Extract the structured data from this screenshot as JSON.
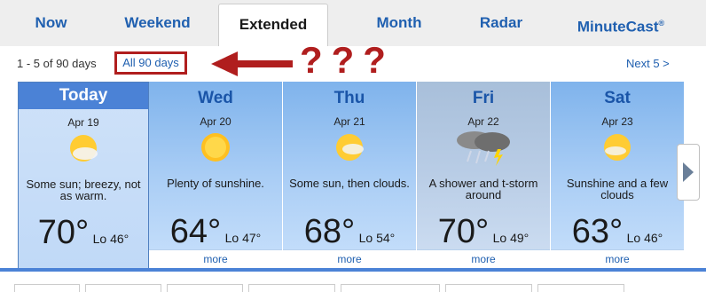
{
  "tabs": [
    {
      "label": "Now"
    },
    {
      "label": "Weekend"
    },
    {
      "label": "Extended"
    },
    {
      "label": "Month"
    },
    {
      "label": "Radar"
    },
    {
      "label": "MinuteCast",
      "sup": "®"
    }
  ],
  "nav": {
    "range": "1 - 5 of 90 days",
    "all_days": "All 90 days",
    "annotation": "???",
    "next": "Next 5 >"
  },
  "days": [
    {
      "name": "Today",
      "date": "Apr 19",
      "icon": "sun-cloud-icon",
      "desc": "Some sun; breezy, not as warm.",
      "hi": "70°",
      "lo": "Lo 46°"
    },
    {
      "name": "Wed",
      "date": "Apr 20",
      "icon": "sun-icon",
      "desc": "Plenty of sunshine.",
      "hi": "64°",
      "lo": "Lo 47°",
      "more": "more"
    },
    {
      "name": "Thu",
      "date": "Apr 21",
      "icon": "sun-cloud-icon",
      "desc": "Some sun, then clouds.",
      "hi": "68°",
      "lo": "Lo 54°",
      "more": "more"
    },
    {
      "name": "Fri",
      "date": "Apr 22",
      "icon": "thunderstorm-icon",
      "desc": "A shower and t-storm around",
      "hi": "70°",
      "lo": "Lo 49°",
      "more": "more"
    },
    {
      "name": "Sat",
      "date": "Apr 23",
      "icon": "sun-cloud-icon",
      "desc": "Sunshine and a few clouds",
      "hi": "63°",
      "lo": "Lo 46°",
      "more": "more"
    }
  ],
  "colors": {
    "accent": "#2060b0",
    "today": "#4b82d6",
    "annotation": "#b01e1e"
  }
}
